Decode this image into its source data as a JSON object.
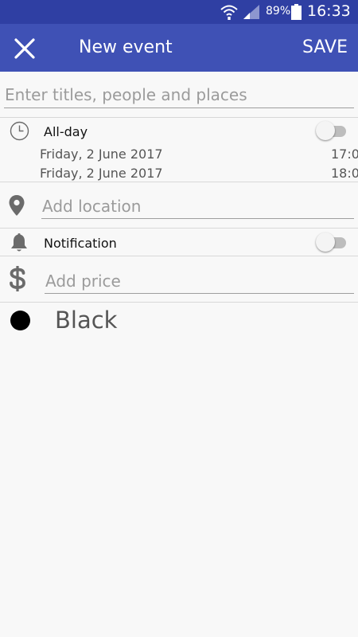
{
  "status_bar": {
    "battery_percent": "89%",
    "time": "16:33",
    "icons": [
      "wifi-icon",
      "signal-icon",
      "battery-icon"
    ]
  },
  "app_bar": {
    "title": "New event",
    "save_label": "SAVE",
    "close_icon": "close-icon",
    "background_color": "#3f51b5",
    "status_bar_color": "#2f3fa3"
  },
  "form": {
    "title_placeholder": "Enter titles, people and places",
    "all_day": {
      "label": "All-day",
      "enabled": false,
      "icon": "clock-icon"
    },
    "start": {
      "date": "Friday, 2 June 2017",
      "time": "17:0"
    },
    "end": {
      "date": "Friday, 2 June 2017",
      "time": "18:0"
    },
    "location": {
      "placeholder": "Add location",
      "icon": "location-pin-icon"
    },
    "notification": {
      "label": "Notification",
      "enabled": false,
      "icon": "bell-icon"
    },
    "price": {
      "placeholder": "Add price",
      "icon": "dollar-icon"
    },
    "color": {
      "label": "Black",
      "value": "#000000",
      "icon": "color-dot-icon"
    }
  }
}
